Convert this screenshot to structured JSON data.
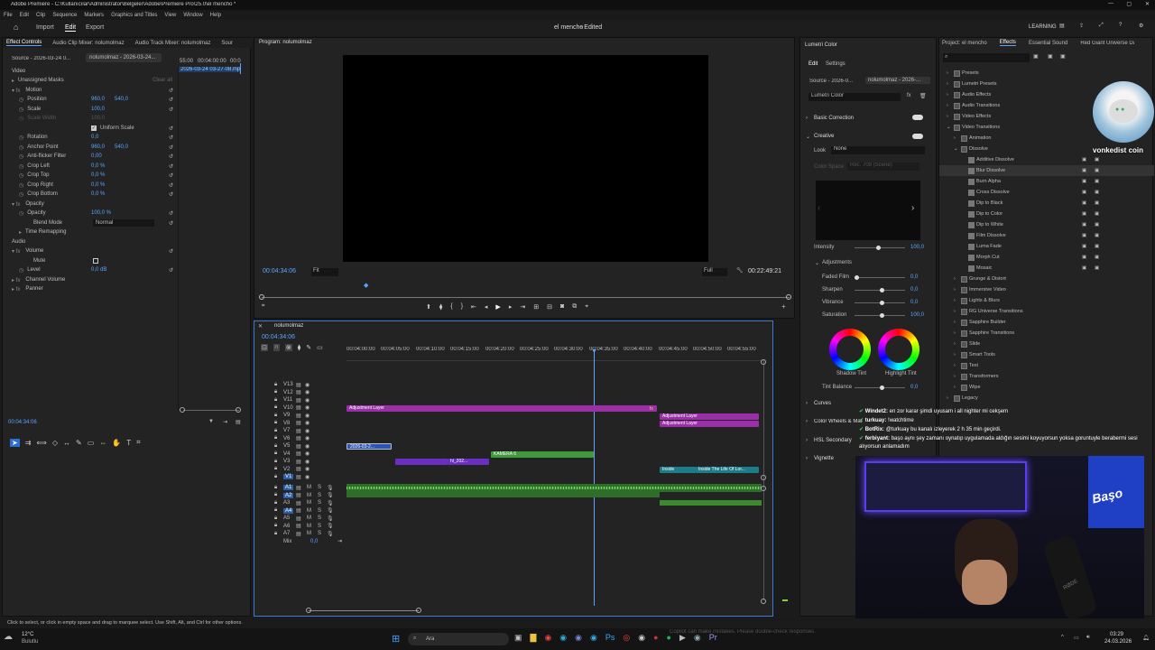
{
  "window": {
    "title": "Adobe Premiere - C:\\Kullanıcılar\\Administrator\\Belgeler\\Adobe\\Premiere Pro\\25.0\\el mencho *"
  },
  "menu": [
    "File",
    "Edit",
    "Clip",
    "Sequence",
    "Markers",
    "Graphics and Titles",
    "View",
    "Window",
    "Help"
  ],
  "appbar": {
    "import": "Import",
    "edit": "Edit",
    "export": "Export",
    "project_name": "el mencho",
    "status": "- Edited",
    "learning": "LEARNING"
  },
  "effect_controls": {
    "tabs": [
      "Effect Controls",
      "Audio Clip Mixer: nolumolmaz",
      "Audio Track Mixer: nolumolmaz",
      "Sour"
    ],
    "source": "Source - 2026-03-24 0...",
    "clip": "nolumolmaz - 2026-03-24...",
    "ruler_start": "55:00",
    "ruler_end": "00:04:00:00",
    "ruler_more": "00:0",
    "clip_label": "2026-03-24 03-27-08.mp4",
    "video": "Video",
    "unassigned": "Unassigned Masks",
    "clear_all": "Clear all",
    "motion": "Motion",
    "position": "Position",
    "pos_x": "960,0",
    "pos_y": "540,0",
    "scale": "Scale",
    "scale_val": "100,0",
    "scale_width": "Scale Width",
    "scale_width_val": "100,0",
    "uniform": "Uniform Scale",
    "rotation": "Rotation",
    "rotation_val": "0,0",
    "anchor": "Anchor Point",
    "anc_x": "960,0",
    "anc_y": "540,0",
    "antiflicker": "Anti-flicker Filter",
    "antiflicker_val": "0,00",
    "crop_left": "Crop Left",
    "crop_top": "Crop Top",
    "crop_right": "Crop Right",
    "crop_bottom": "Crop Bottom",
    "crop_val": "0,0 %",
    "opacity_group": "Opacity",
    "opacity": "Opacity",
    "opacity_val": "100,0 %",
    "blend": "Blend Mode",
    "blend_val": "Normal",
    "time_remap": "Time Remapping",
    "audio": "Audio",
    "volume": "Volume",
    "mute": "Mute",
    "level": "Level",
    "level_val": "0,0 dB",
    "channel_volume": "Channel Volume",
    "panner": "Panner",
    "timecode": "00:04:34:06"
  },
  "program": {
    "title": "Program: nolumolmaz",
    "timecode": "00:04:34:06",
    "fit": "Fit",
    "full": "Full",
    "duration": "00:22:49:21"
  },
  "timeline": {
    "seq": "nolumolmaz",
    "timecode": "00:04:34:06",
    "ruler": [
      "00:04:00:00",
      "00:04:05:00",
      "00:04:10:00",
      "00:04:15:00",
      "00:04:20:00",
      "00:04:25:00",
      "00:04:30:00",
      "00:04:35:00",
      "00:04:40:00",
      "00:04:45:00",
      "00:04:50:00",
      "00:04:55:00"
    ],
    "video_tracks": [
      "V13",
      "V12",
      "V11",
      "V10",
      "V9",
      "V8",
      "V7",
      "V6",
      "V5",
      "V4",
      "V3",
      "V2",
      "V1"
    ],
    "audio_tracks": [
      "A1",
      "A2",
      "A3",
      "A4",
      "A5",
      "A6",
      "A7",
      "Mix"
    ],
    "mix_val": "0,0",
    "clips": {
      "adj1": "Adjustment Layer",
      "adj2": "Adjustment Layer",
      "adj3": "Adjustment Layer",
      "c2026": "2026-03-2...",
      "kamera": "KAMERA 6",
      "hl": "hl_202...",
      "inside1": "Inside",
      "inside2": "Inside The Life Of Lor..."
    }
  },
  "lumetri": {
    "title": "Lumetri Color",
    "edit": "Edit",
    "settings": "Settings",
    "source": "Source - 2026-0...",
    "clip": "nolumolmaz - 2026-...",
    "dropdown": "Lumetri Color",
    "basic": "Basic Correction",
    "creative": "Creative",
    "look": "Look",
    "look_val": "None",
    "color_space": "Color Space",
    "color_space_val": "Rec. 709 (Scene)",
    "intensity": "Intensity",
    "intensity_val": "100,0",
    "adjustments": "Adjustments",
    "faded": "Faded Film",
    "faded_val": "0,0",
    "sharpen": "Sharpen",
    "sharpen_val": "0,0",
    "vibrance": "Vibrance",
    "vibrance_val": "0,0",
    "saturation": "Saturation",
    "saturation_val": "100,0",
    "shadow_tint": "Shadow Tint",
    "highlight_tint": "Highlight Tint",
    "tint_balance": "Tint Balance",
    "tint_val": "0,0",
    "curves": "Curves",
    "wheels": "Color Wheels & Match",
    "hsl": "HSL Secondary",
    "vignette": "Vignette"
  },
  "effects": {
    "tabs": [
      "Project: el mencho",
      "Effects",
      "Essential Sound",
      "Red Giant Universe Dashb"
    ],
    "tree": [
      "Presets",
      "Lumetri Presets",
      "Audio Effects",
      "Audio Transitions",
      "Video Effects",
      "Video Transitions",
      "Animation",
      "Dissolve",
      "Additive Dissolve",
      "Blur Dissolve",
      "Burn Alpha",
      "Cross Dissolve",
      "Dip to Black",
      "Dip to Color",
      "Dip to White",
      "Film Dissolve",
      "Luma Fade",
      "Morph Cut",
      "Mosaic",
      "Grunge & Distort",
      "Immersive Video",
      "Lights & Blurs",
      "RG Universe Transitions",
      "Sapphire Builder",
      "Sapphire Transitions",
      "Slide",
      "Smart Tools",
      "Text",
      "Transformers",
      "Wipe",
      "Legacy"
    ],
    "overlay_name": "vonkedist coin"
  },
  "chat": [
    {
      "user": "Windet2:",
      "msg": "en zor karar şimdi uyusam i all nighter mi cekşem"
    },
    {
      "user": "turkuay:",
      "msg": "!watchtime"
    },
    {
      "user": "BotRix:",
      "msg": "@turkuay bu kanalı izleyerek 2 h 35 min geçirdi."
    },
    {
      "user": "ferbiyant:",
      "msg": "başo aynı şey zamanı oynatıp uygulamada aldığın sesimi koyuyorsun yoksa goruntuyle berabermi sesi alıyorsun anlamadım"
    }
  ],
  "webcam": {
    "logo": "Başo",
    "mic": "RØDE"
  },
  "status_bar": "Click to select, or click in empty space and drag to marquee select. Use Shift, Alt, and Ctrl for other options.",
  "taskbar": {
    "temp": "12°C",
    "weather": "Bulutlu",
    "search": "Ara",
    "time": "03:29",
    "date": "24.03.2026",
    "ghost": "Copilot can make mistakes. Please double-check responses."
  },
  "colors": {
    "adjustment": "#9b2fa8",
    "green": "#3e9a3a",
    "audio_green": "#4caf3d",
    "accent": "#2b8bff",
    "teal": "#1d7c8a"
  }
}
